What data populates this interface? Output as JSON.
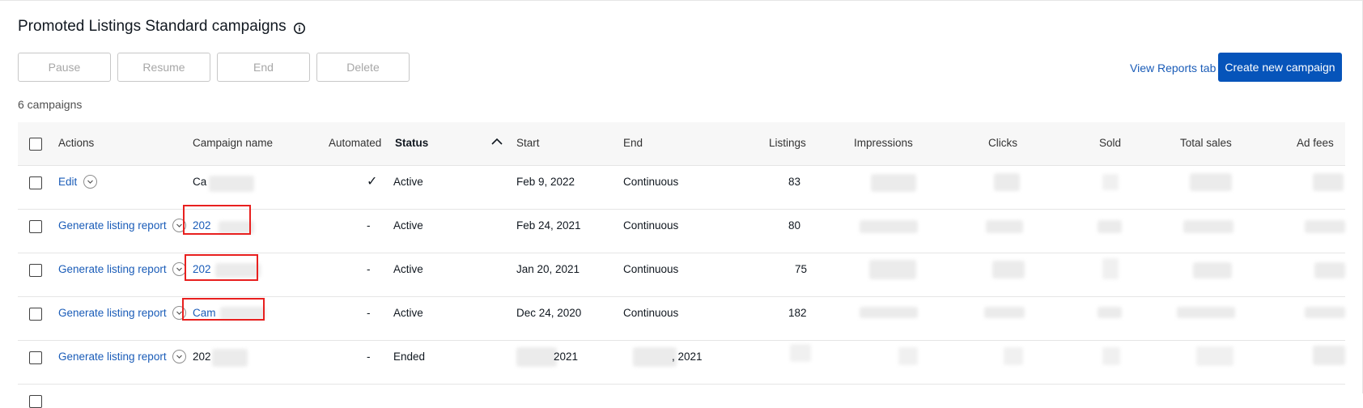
{
  "page": {
    "title": "Promoted Listings Standard campaigns",
    "info_icon": "info-icon"
  },
  "toolbar": {
    "pause_label": "Pause",
    "resume_label": "Resume",
    "end_label": "End",
    "delete_label": "Delete",
    "reports_link": "View Reports tab",
    "create_label": "Create new campaign"
  },
  "summary": {
    "count_text": "6 campaigns"
  },
  "table": {
    "headers": {
      "actions": "Actions",
      "campaign_name": "Campaign name",
      "automated": "Automated",
      "status": "Status",
      "start": "Start",
      "end": "End",
      "listings": "Listings",
      "impressions": "Impressions",
      "clicks": "Clicks",
      "sold": "Sold",
      "total_sales": "Total sales",
      "ad_fees": "Ad fees"
    },
    "sort": {
      "column": "status",
      "direction": "ascending",
      "icon": "chevron-up-icon"
    },
    "rows": [
      {
        "action": "Edit",
        "name": "Ca",
        "automated": "✓",
        "status": "Active",
        "start": "Feb 9, 2022",
        "end": "Continuous",
        "listings": "83"
      },
      {
        "action": "Generate listing report",
        "name": "202",
        "automated": "-",
        "status": "Active",
        "start": "Feb 24, 2021",
        "end": "Continuous",
        "listings": "80"
      },
      {
        "action": "Generate listing report",
        "name": "202",
        "automated": "-",
        "status": "Active",
        "start": "Jan 20, 2021",
        "end": "Continuous",
        "listings": "75"
      },
      {
        "action": "Generate listing report",
        "name": "Cam",
        "automated": "-",
        "status": "Active",
        "start": "Dec 24, 2020",
        "end": "Continuous",
        "listings": "182"
      },
      {
        "action": "Generate listing report",
        "name": "202",
        "automated": "-",
        "status": "Ended",
        "start": "2021",
        "end": ", 2021",
        "listings": ""
      }
    ]
  },
  "colors": {
    "link": "#1a5cb8",
    "primary_button": "#0654ba",
    "highlight_box": "#e8201f",
    "header_bg": "#f7f7f7"
  }
}
